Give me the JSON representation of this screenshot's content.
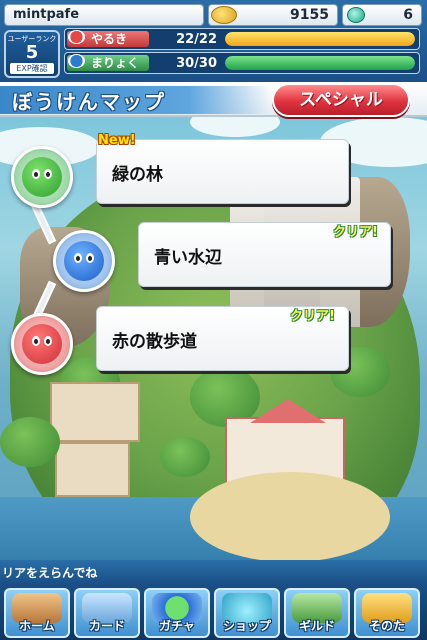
{
  "header": {
    "username": "mintpafe",
    "coins": "9155",
    "gems": "6",
    "rank_label": "ユーザーランク",
    "rank": "5",
    "exp_label": "EXP確認",
    "stamina": {
      "label": "やるき",
      "value": "22/22",
      "level": 1.0
    },
    "magic": {
      "label": "まりょく",
      "value": "30/30",
      "level": 1.0
    }
  },
  "title": "ぼうけんマップ",
  "special_button": "スペシャル",
  "areas": [
    {
      "name": "緑の林",
      "badge": "New!",
      "color": "green"
    },
    {
      "name": "青い水辺",
      "badge": "クリア!",
      "color": "blue"
    },
    {
      "name": "赤の散歩道",
      "badge": "クリア!",
      "color": "red"
    }
  ],
  "hint": "リアをえらんでね",
  "nav": [
    {
      "label": "ホーム",
      "icon": "home-icon"
    },
    {
      "label": "カード",
      "icon": "card-icon"
    },
    {
      "label": "ガチャ",
      "icon": "gacha-icon"
    },
    {
      "label": "ショップ",
      "icon": "shop-icon"
    },
    {
      "label": "ギルド",
      "icon": "guild-icon"
    },
    {
      "label": "そのた",
      "icon": "other-icon"
    }
  ],
  "colors": {
    "header_blue": "#1b4f86",
    "special_red": "#e0343f",
    "stamina_bar": "#f0a51b",
    "magic_bar": "#1fa34a"
  }
}
